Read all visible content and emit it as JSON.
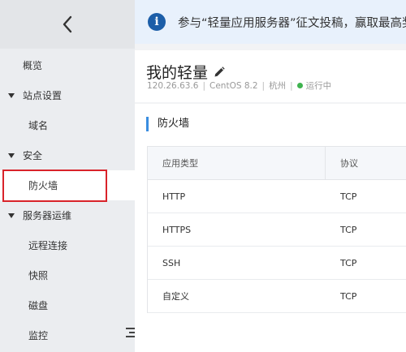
{
  "sidebar": {
    "items": [
      {
        "label": "概览",
        "kind": "top"
      },
      {
        "label": "站点设置",
        "kind": "group"
      },
      {
        "label": "域名",
        "kind": "sub"
      },
      {
        "label": "安全",
        "kind": "group"
      },
      {
        "label": "防火墙",
        "kind": "sub",
        "active": true
      },
      {
        "label": "服务器运维",
        "kind": "group"
      },
      {
        "label": "远程连接",
        "kind": "sub"
      },
      {
        "label": "快照",
        "kind": "sub"
      },
      {
        "label": "磁盘",
        "kind": "sub"
      },
      {
        "label": "监控",
        "kind": "sub"
      }
    ],
    "highlight_color": "#d9232a"
  },
  "banner": {
    "icon": "info-icon",
    "icon_glyph": "i",
    "text": "参与“轻量应用服务器”征文投稿，赢取最高奖"
  },
  "header": {
    "title": "我的轻量",
    "ip": "120.26.63.6",
    "os": "CentOS 8.2",
    "region": "杭州",
    "status": "运行中",
    "status_color": "#3fb34f"
  },
  "firewall": {
    "title": "防火墙",
    "columns": [
      "应用类型",
      "协议"
    ],
    "rows": [
      [
        "HTTP",
        "TCP"
      ],
      [
        "HTTPS",
        "TCP"
      ],
      [
        "SSH",
        "TCP"
      ],
      [
        "自定义",
        "TCP"
      ]
    ]
  },
  "colors": {
    "accent": "#3a8de0",
    "info_icon": "#1c5ea8",
    "banner_bg": "#e8f1fc"
  }
}
